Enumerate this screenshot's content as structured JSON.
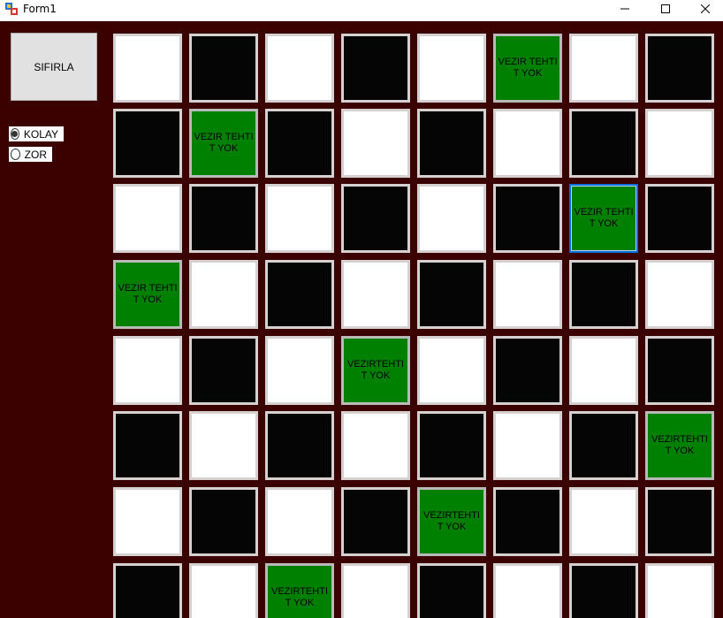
{
  "window": {
    "title": "Form1"
  },
  "controls": {
    "reset_label": "SIFIRLA",
    "difficulty": [
      {
        "label": "KOLAY",
        "selected": true
      },
      {
        "label": "ZOR",
        "selected": false
      }
    ]
  },
  "colors": {
    "background": "#3b0000",
    "light_square": "#ffffff",
    "dark_square": "#050505",
    "queen_square": "#008000",
    "focus": "#0b6fd8"
  },
  "board": {
    "rows": [
      [
        "",
        "",
        "",
        "",
        "",
        "VEZIR TEHTIT YOK",
        "",
        ""
      ],
      [
        "",
        "VEZIR TEHTIT YOK",
        "",
        "",
        "",
        "",
        "",
        ""
      ],
      [
        "",
        "",
        "",
        "",
        "",
        "",
        "VEZIR TEHTIT YOK",
        ""
      ],
      [
        "VEZIR TEHTIT YOK",
        "",
        "",
        "",
        "",
        "",
        "",
        ""
      ],
      [
        "",
        "",
        "",
        "VEZIRTEHTIT YOK",
        "",
        "",
        "",
        ""
      ],
      [
        "",
        "",
        "",
        "",
        "",
        "",
        "",
        "VEZIRTEHTIT YOK"
      ],
      [
        "",
        "",
        "",
        "",
        "VEZIRTEHTIT YOK",
        "",
        "",
        ""
      ],
      [
        "",
        "",
        "VEZIRTEHTIT YOK",
        "",
        "",
        "",
        "",
        ""
      ]
    ]
  }
}
